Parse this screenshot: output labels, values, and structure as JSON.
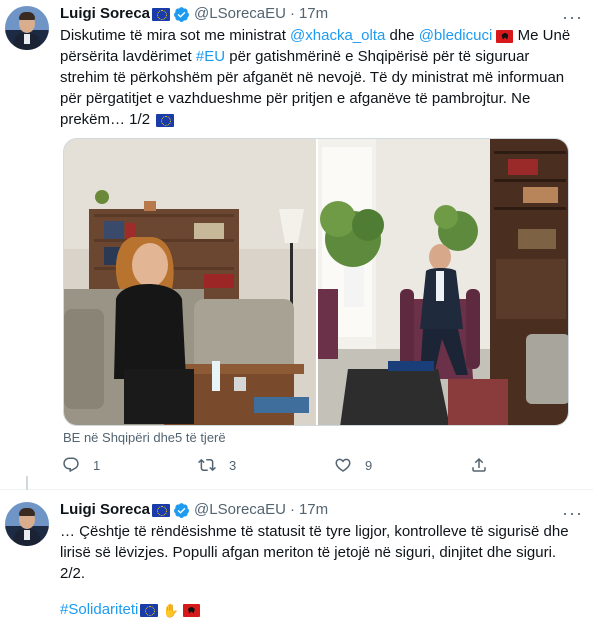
{
  "tweet1": {
    "author_name": "Luigi Soreca",
    "handle": "@LSorecaEU",
    "separator": "·",
    "time": "17m",
    "more_label": "···",
    "text": {
      "p1": "Diskutime të mira sot me ministrat ",
      "mention1": "@xhacka_olta",
      "p2": " dhe ",
      "mention2": "@bledicuci",
      "p3": " Me Unë përsërita lavdërimet ",
      "hashtag": "#EU",
      "p4": " për gatishmërinë e Shqipërisë për të siguruar strehim të përkohshëm për afganët në nevojë. Të dy ministrat më informuan për përgatitjet e vazhdueshme për pritjen e afganëve të pambrojtur. Ne prekëm… 1/2"
    },
    "tagline": "BE në Shqipëri dhe5 të tjerë",
    "actions": {
      "reply_count": "1",
      "retweet_count": "3",
      "like_count": "9"
    }
  },
  "tweet2": {
    "author_name": "Luigi Soreca",
    "handle": "@LSorecaEU",
    "separator": "·",
    "time": "17m",
    "more_label": "···",
    "text": {
      "body": "… Çështje të rëndësishme të statusit të tyre ligjor, kontrolleve të sigurisë dhe lirisë së lëvizjes. Populli afgan meriton të jetojë në siguri, dinjitet dhe siguri. 2/2.",
      "hashtag": "#Solidariteti"
    }
  },
  "colors": {
    "accent": "#1d9bf0",
    "secondary_text": "#536471",
    "primary_text": "#0f1419"
  },
  "icons": [
    "verified-badge-icon",
    "eu-flag-icon",
    "albania-flag-icon",
    "reply-icon",
    "retweet-icon",
    "like-icon",
    "share-icon",
    "handshake-icon",
    "more-icon"
  ]
}
